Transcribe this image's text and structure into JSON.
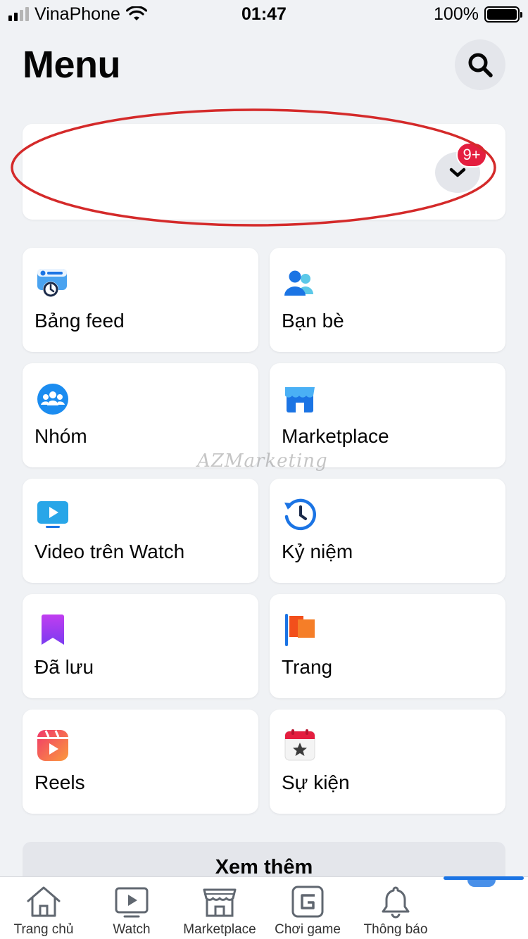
{
  "status_bar": {
    "carrier": "VinaPhone",
    "time": "01:47",
    "battery": "100%"
  },
  "header": {
    "title": "Menu",
    "search_icon": "search-icon"
  },
  "profile": {
    "badge": "9+",
    "dropdown_icon": "chevron-down-icon"
  },
  "shortcuts": [
    {
      "label": "Bảng feed",
      "icon": "feed-icon"
    },
    {
      "label": "Bạn bè",
      "icon": "friends-icon"
    },
    {
      "label": "Nhóm",
      "icon": "groups-icon"
    },
    {
      "label": "Marketplace",
      "icon": "marketplace-icon"
    },
    {
      "label": "Video trên Watch",
      "icon": "watch-video-icon"
    },
    {
      "label": "Kỷ niệm",
      "icon": "memories-icon"
    },
    {
      "label": "Đã lưu",
      "icon": "saved-icon"
    },
    {
      "label": "Trang",
      "icon": "pages-flag-icon"
    },
    {
      "label": "Reels",
      "icon": "reels-icon"
    },
    {
      "label": "Sự kiện",
      "icon": "events-icon"
    }
  ],
  "see_more": "Xem thêm",
  "watermark": "AZMarketing",
  "bottom_nav": [
    {
      "label": "Trang chủ",
      "icon": "home-icon"
    },
    {
      "label": "Watch",
      "icon": "watch-icon"
    },
    {
      "label": "Marketplace",
      "icon": "marketplace-icon"
    },
    {
      "label": "Chơi game",
      "icon": "gaming-icon"
    },
    {
      "label": "Thông báo",
      "icon": "bell-icon"
    }
  ],
  "colors": {
    "background": "#f0f2f5",
    "brand_blue": "#1b74e4",
    "badge_red": "#e41e3f",
    "annotation_red": "#d42a2a"
  }
}
